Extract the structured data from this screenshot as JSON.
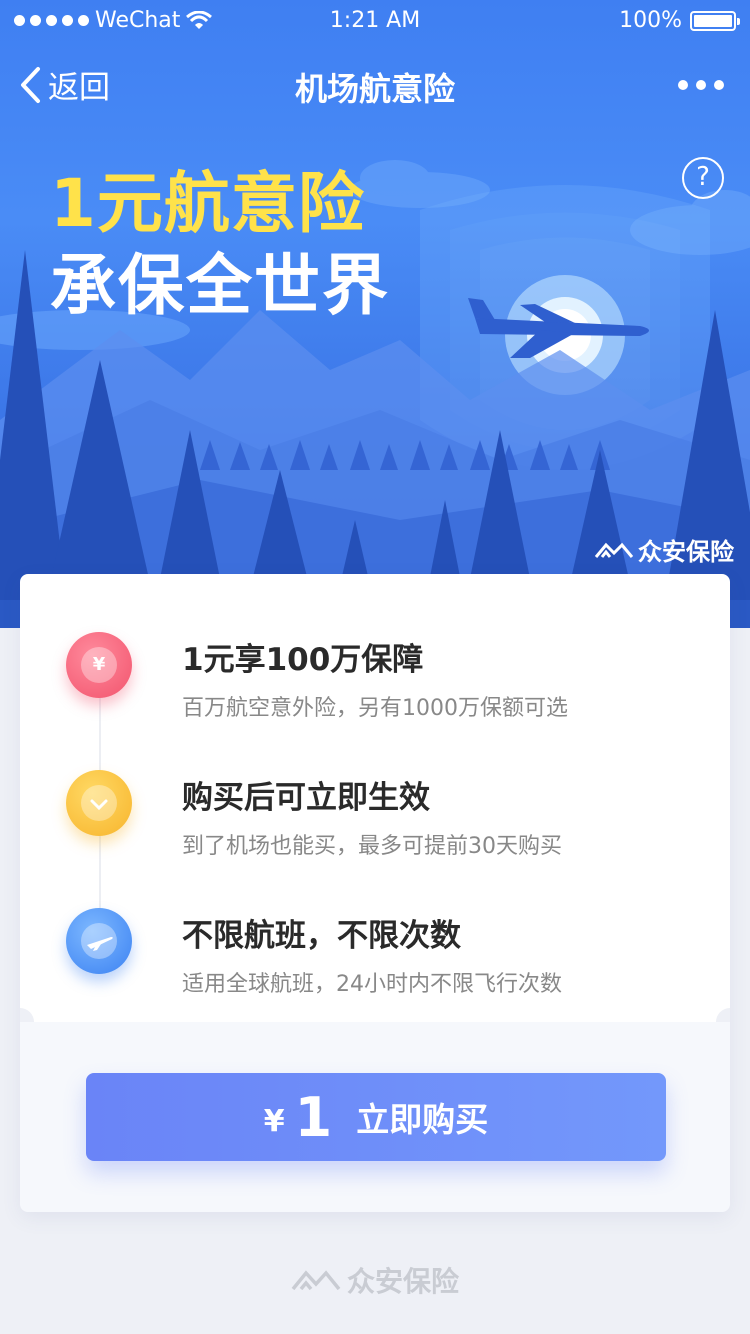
{
  "status_bar": {
    "carrier": "WeChat",
    "time": "1:21 AM",
    "battery": "100%",
    "battery_level": 1.0
  },
  "nav": {
    "back_label": "返回",
    "title": "机场航意险"
  },
  "hero": {
    "title": "1元航意险",
    "subtitle": "承保全世界",
    "help_symbol": "?",
    "brand": "众安保险"
  },
  "features": [
    {
      "icon": "yuan-coin-icon",
      "title": "1元享100万保障",
      "desc": "百万航空意外险，另有1000万保额可选"
    },
    {
      "icon": "check-badge-icon",
      "title": "购买后可立即生效",
      "desc": "到了机场也能买，最多可提前30天购买"
    },
    {
      "icon": "airplane-icon",
      "title": "不限航班，不限次数",
      "desc": "适用全球航班，24小时内不限飞行次数"
    }
  ],
  "buy": {
    "currency": "¥",
    "price": "1",
    "label": "立即购买"
  },
  "footer": {
    "brand": "众安保险"
  },
  "colors": {
    "hero_blue": "#3f7ff2",
    "title_yellow": "#ffe24a",
    "button_purple": "#6a84f7",
    "pink": "#f2546d",
    "yellow": "#f7b42c",
    "blue": "#3c82f2"
  }
}
